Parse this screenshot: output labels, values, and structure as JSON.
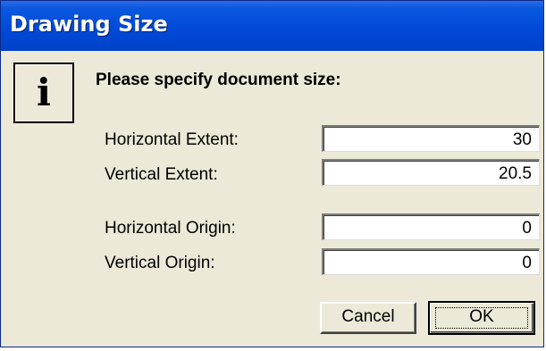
{
  "dialog": {
    "title": "Drawing Size",
    "heading": "Please specify document size:",
    "info_icon_glyph": "i",
    "colors": {
      "titlebar": "#0048d6",
      "face": "#ece9d8"
    }
  },
  "fields": [
    {
      "label": "Horizontal Extent:",
      "value": "30"
    },
    {
      "label": "Vertical Extent:",
      "value": "20.5"
    },
    {
      "label": "Horizontal Origin:",
      "value": "0"
    },
    {
      "label": "Vertical Origin:",
      "value": "0"
    }
  ],
  "buttons": {
    "cancel": "Cancel",
    "ok": "OK"
  }
}
